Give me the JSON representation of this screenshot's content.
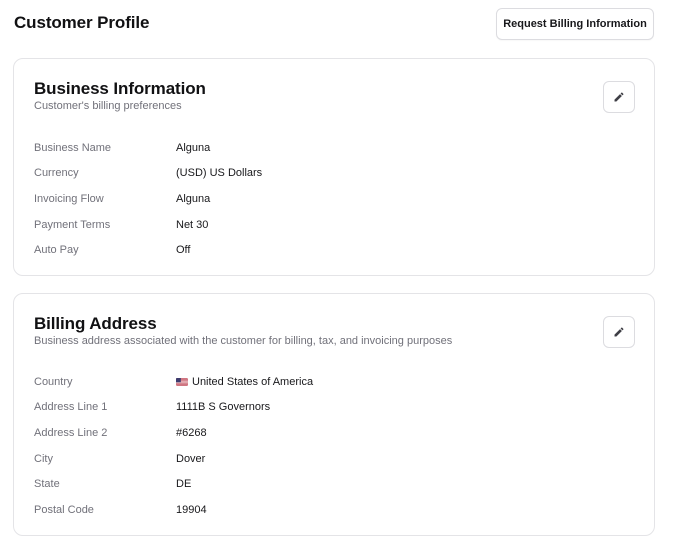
{
  "header": {
    "title": "Customer Profile",
    "request_button_label": "Request Billing Information"
  },
  "business_info": {
    "title": "Business Information",
    "subtitle": "Customer's billing preferences",
    "edit_icon": "pencil-icon",
    "fields": [
      {
        "label": "Business Name",
        "value": "Alguna"
      },
      {
        "label": "Currency",
        "value": "(USD) US Dollars"
      },
      {
        "label": "Invoicing Flow",
        "value": "Alguna"
      },
      {
        "label": "Payment Terms",
        "value": "Net 30"
      },
      {
        "label": "Auto Pay",
        "value": "Off"
      }
    ]
  },
  "billing_address": {
    "title": "Billing Address",
    "subtitle": "Business address associated with the customer for billing, tax, and invoicing purposes",
    "edit_icon": "pencil-icon",
    "country_flag_icon": "us-flag-icon",
    "fields": [
      {
        "label": "Country",
        "value": "United States of America"
      },
      {
        "label": "Address Line 1",
        "value": "1111B S Governors"
      },
      {
        "label": "Address Line 2",
        "value": "#6268"
      },
      {
        "label": "City",
        "value": "Dover"
      },
      {
        "label": "State",
        "value": "DE"
      },
      {
        "label": "Postal Code",
        "value": "19904"
      }
    ]
  },
  "colors": {
    "text_primary": "#18181b",
    "text_muted": "#71717a",
    "border": "#e4e4e7"
  }
}
